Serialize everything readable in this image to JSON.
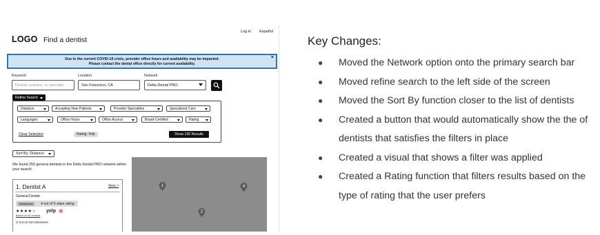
{
  "mockup": {
    "header": {
      "logo": "LOGO",
      "title": "Find a dentist",
      "login": "Log in",
      "language": "Español"
    },
    "banner": {
      "line1": "Due to the current COVID-19 crisis, provider office hours and availability may be impacted.",
      "line2": "Please contact the dental office directly for current availability.",
      "close": "×"
    },
    "search": {
      "keyword_label": "Keyword",
      "keyword_placeholder": "Dentist, practice, or specialty",
      "location_label": "Location",
      "location_value": "San Francisco, CA",
      "network_label": "Network",
      "network_value": "Delta Dental PRO"
    },
    "refine": {
      "label": "Refine Search",
      "filters_row1": [
        "Distance",
        "Accepting New Patients",
        "Provider Specialties",
        "Specialized Care"
      ],
      "filters_row2": [
        "Languages",
        "Office Hours",
        "Office Access",
        "Board-Certified",
        "Rating"
      ],
      "clear": "Clear Selection",
      "chip": "Rating: Yelp",
      "show_button": "Show 130 Results"
    },
    "sort": {
      "label": "Sort By: Distance"
    },
    "results_text": "We found 250 general dentists in the Delta Dental PRO network within your search.",
    "card": {
      "name": "1. Dentist A",
      "view": "View >",
      "type": "General Dentist",
      "rating_tag": "DentalQuest",
      "rating_text": "4 out of 5 stars rating",
      "stars": "★★★★☆",
      "reviews": "Based on 50 reviews",
      "yelp": "yelp",
      "distance": "0.8 mi  Get directions"
    },
    "map_pins": [
      "1",
      "4",
      "2"
    ]
  },
  "notes": {
    "title": "Key Changes:",
    "items": [
      "Moved the Network option onto the primary search bar",
      "Moved refine search to the left side of the screen",
      "Moved the Sort By function closer to the list of dentists",
      "Created a button that would automatically show the the of dentists that satisfies the filters in place",
      "Created a visual that shows a filter was applied",
      "Created a Rating function that filters results based on the type of rating that the user prefers"
    ]
  }
}
